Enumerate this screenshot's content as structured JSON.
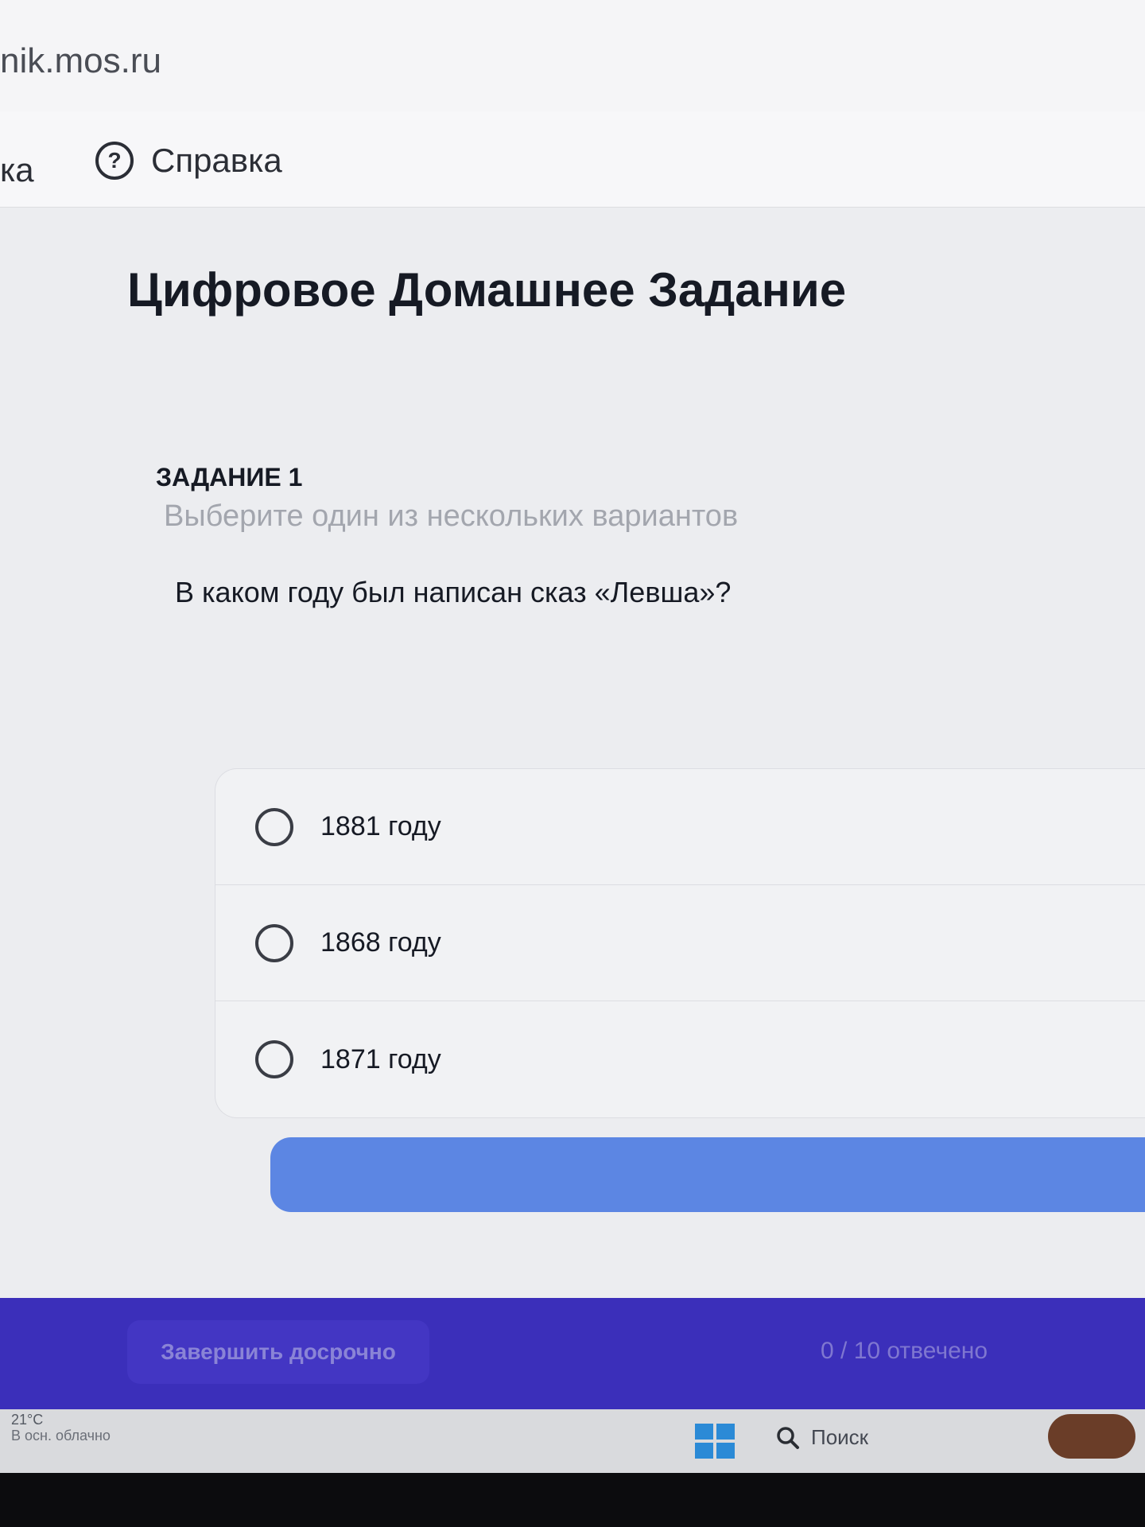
{
  "browser": {
    "url": "nik.mos.ru"
  },
  "nav": {
    "left_label": "ка",
    "help_label": "Справка",
    "help_icon": "question-circle-icon"
  },
  "page": {
    "title": "Цифровое Домашнее Задание"
  },
  "task": {
    "number": "ЗАДАНИЕ 1",
    "hint": "Выберите один из нескольких вариантов",
    "question": "В каком году был написан сказ «Левша»?",
    "options": [
      {
        "label": "1881 году"
      },
      {
        "label": "1868 году"
      },
      {
        "label": "1871 году"
      }
    ]
  },
  "footer": {
    "finish_early": "Завершить досрочно",
    "answered": "0 / 10 отвечено",
    "color": "#3b2fba"
  },
  "taskbar": {
    "temperature": "21°C",
    "weather": "В осн. облачно",
    "search_label": "Поиск",
    "start_icon": "windows-logo-icon",
    "search_icon": "magnifier-icon"
  }
}
